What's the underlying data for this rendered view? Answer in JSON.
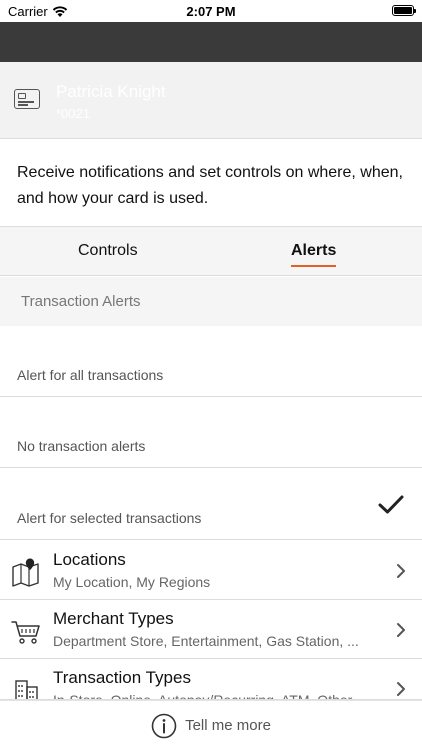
{
  "status_bar": {
    "carrier": "Carrier",
    "time": "2:07 PM"
  },
  "card": {
    "name": "Patricia Knight",
    "number": "*0021"
  },
  "description": "Receive notifications and set controls on where, when, and how your card is used.",
  "tabs": [
    {
      "label": "Controls",
      "selected": false
    },
    {
      "label": "Alerts",
      "selected": true
    }
  ],
  "accent_color": "#e06228",
  "section_title": "Transaction Alerts",
  "alert_options": [
    {
      "label": "Alert for all transactions",
      "checked": false
    },
    {
      "label": "No transaction alerts",
      "checked": false
    },
    {
      "label": "Alert for selected transactions",
      "checked": true
    }
  ],
  "categories": [
    {
      "icon": "map-pin-icon",
      "title": "Locations",
      "subtitle": "My Location, My Regions"
    },
    {
      "icon": "cart-icon",
      "title": "Merchant Types",
      "subtitle": "Department Store, Entertainment, Gas Station, ..."
    },
    {
      "icon": "building-icon",
      "title": "Transaction Types",
      "subtitle": "In-Store, Online, Autopay/Recurring, ATM, Other"
    }
  ],
  "footer": {
    "label": "Tell me more"
  }
}
